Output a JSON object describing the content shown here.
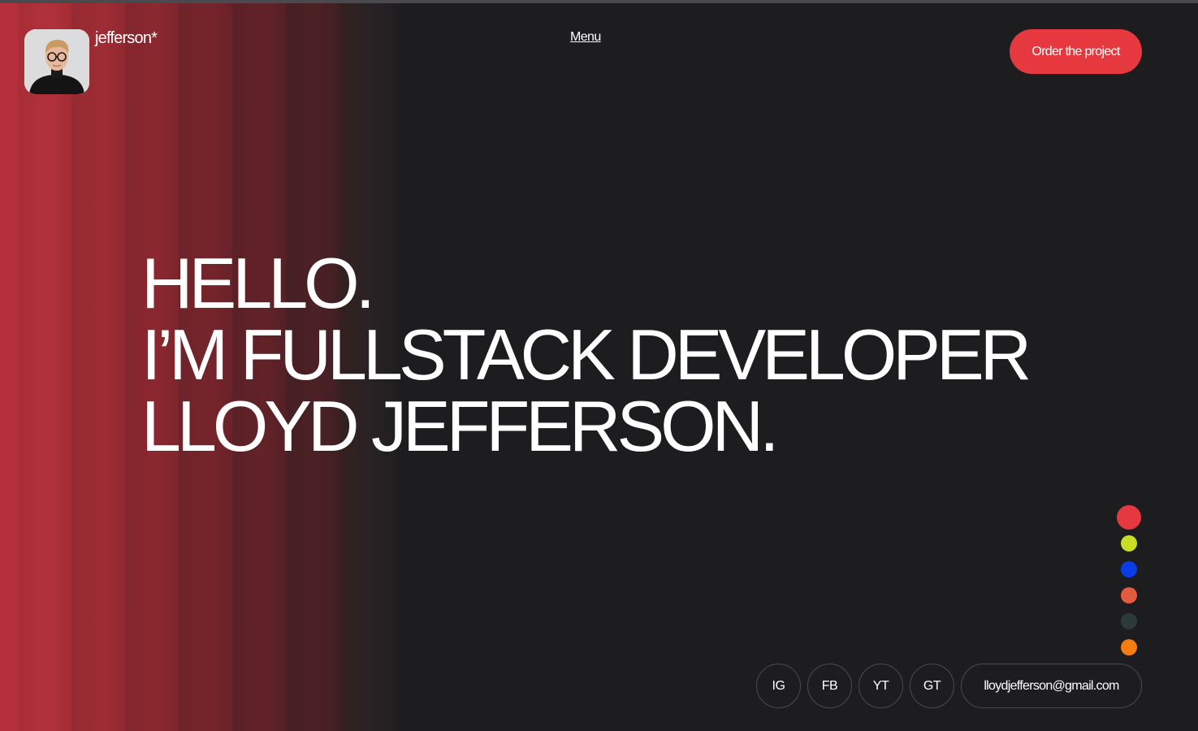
{
  "header": {
    "brand": "jefferson*",
    "menu_label": "Menu",
    "cta_label": "Order the project"
  },
  "hero": {
    "lines": [
      "HELLO.",
      "I’M FULLSTACK DEVELOPER",
      "LLOYD JEFFERSON."
    ]
  },
  "theme_palette": {
    "colors": [
      "#e5393f",
      "#c8dd24",
      "#0a3de8",
      "#e35a3c",
      "#2d3b38",
      "#f57c10"
    ]
  },
  "socials": {
    "items": [
      "IG",
      "FB",
      "YT",
      "GT"
    ],
    "email": "lloydjefferson@gmail.com"
  },
  "colors": {
    "background": "#1d1d20",
    "accent": "#e5393f",
    "stripe_red": "#b5303a"
  }
}
